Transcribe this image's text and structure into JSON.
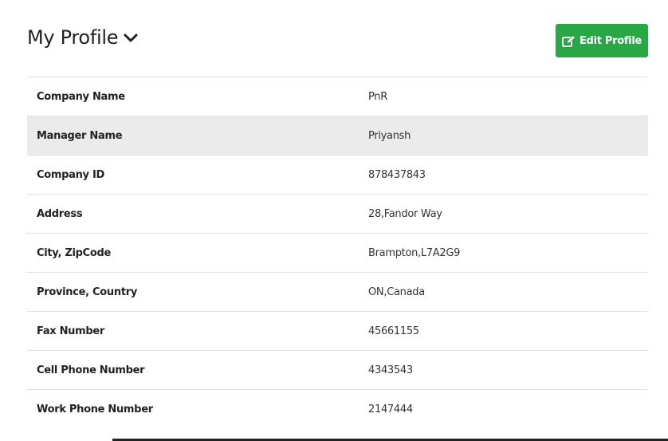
{
  "header": {
    "title": "My Profile",
    "toggle_icon": "chevron-down-icon",
    "edit_button": {
      "label": "Edit Profile",
      "icon": "edit-icon",
      "color": "#28a745"
    }
  },
  "profile": {
    "rows": [
      {
        "label": "Company Name",
        "value": "PnR"
      },
      {
        "label": "Manager Name",
        "value": "Priyansh"
      },
      {
        "label": "Company ID",
        "value": "878437843"
      },
      {
        "label": "Address",
        "value": "28,Fandor Way"
      },
      {
        "label": "City, ZipCode",
        "value": "Brampton,L7A2G9"
      },
      {
        "label": "Province, Country",
        "value": "ON,Canada"
      },
      {
        "label": "Fax Number",
        "value": "45661155"
      },
      {
        "label": "Cell Phone Number",
        "value": "4343543"
      },
      {
        "label": "Work Phone Number",
        "value": "2147444"
      }
    ]
  }
}
